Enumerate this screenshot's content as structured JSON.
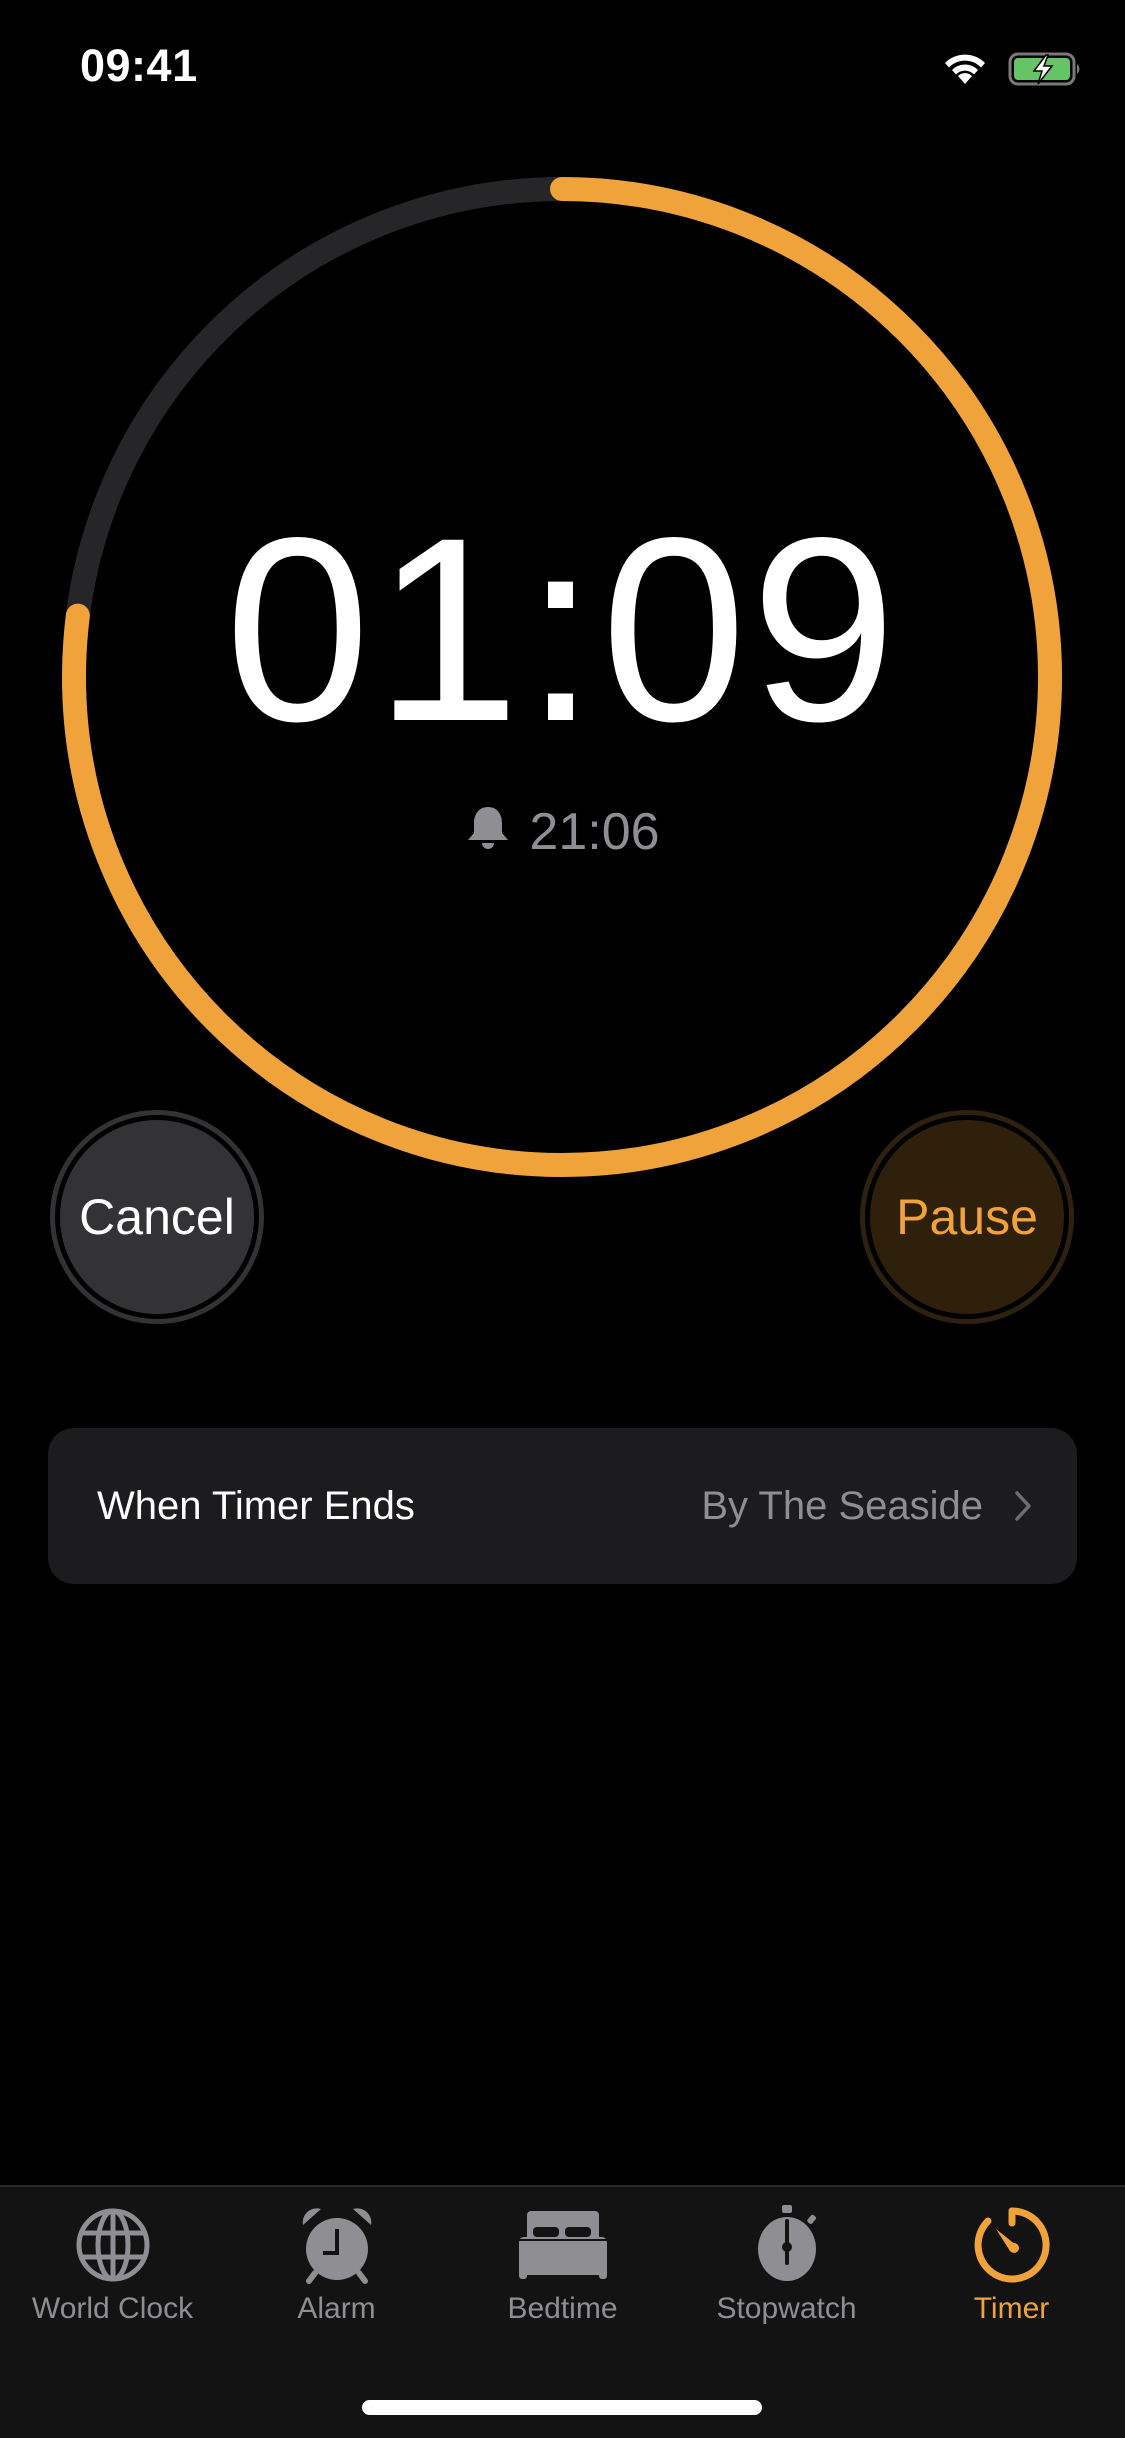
{
  "status_bar": {
    "time": "09:41",
    "wifi_icon": "wifi-icon",
    "battery_icon": "battery-charging-icon",
    "battery_color": "#65c466"
  },
  "timer": {
    "remaining": "01:09",
    "remaining_parts": [
      "0",
      "1",
      ":",
      "0",
      "9"
    ],
    "end_time": "21:06",
    "end_icon": "bell-icon",
    "progress_remaining_fraction": 0.77,
    "accent_color": "#f0a23b",
    "track_color": "#262628"
  },
  "buttons": {
    "cancel_label": "Cancel",
    "pause_label": "Pause"
  },
  "settings_row": {
    "label": "When Timer Ends",
    "value": "By The Seaside",
    "chevron_icon": "chevron-right-icon"
  },
  "tab_bar": {
    "active_index": 4,
    "items": [
      {
        "label": "World Clock",
        "icon": "globe-icon"
      },
      {
        "label": "Alarm",
        "icon": "alarm-clock-icon"
      },
      {
        "label": "Bedtime",
        "icon": "bed-icon"
      },
      {
        "label": "Stopwatch",
        "icon": "stopwatch-icon"
      },
      {
        "label": "Timer",
        "icon": "timer-icon"
      }
    ]
  }
}
